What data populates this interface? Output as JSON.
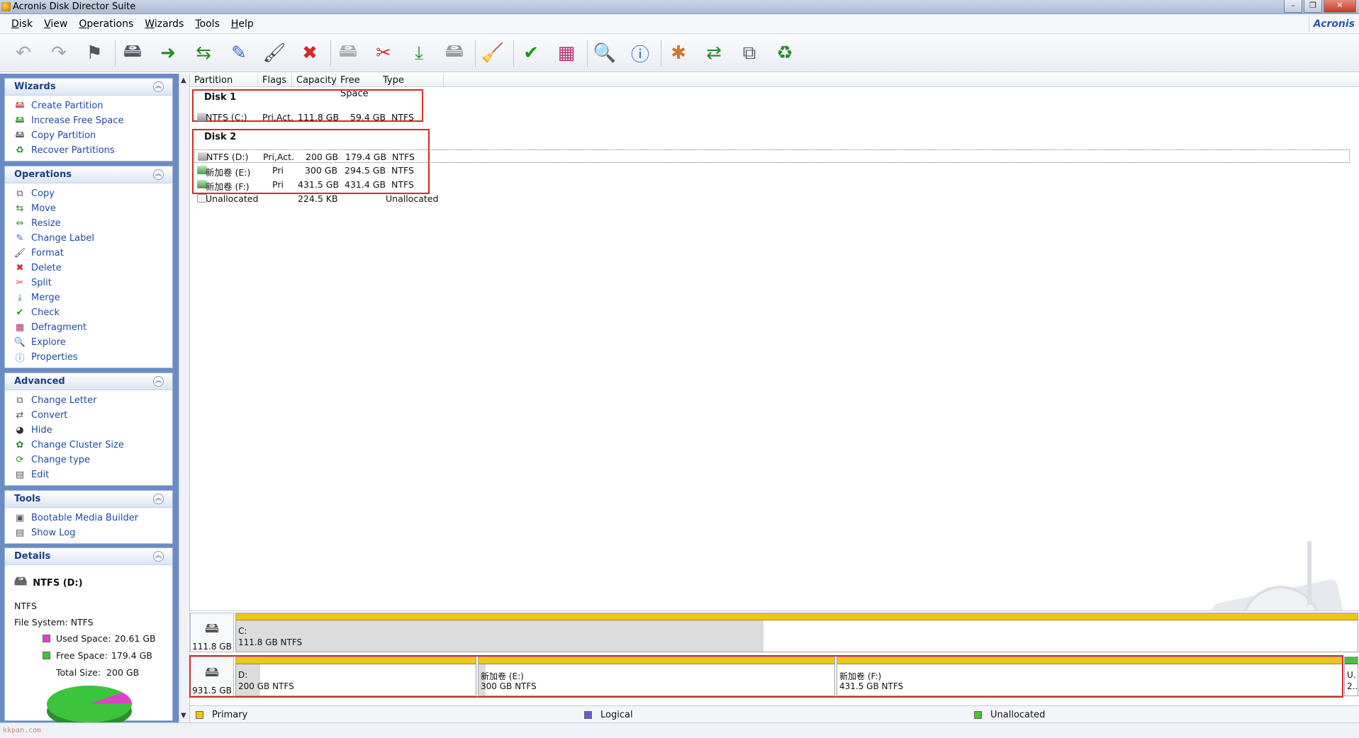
{
  "window": {
    "title": "Acronis Disk Director Suite",
    "brand": "Acronis"
  },
  "menu": [
    {
      "label": "Disk",
      "ul": "D",
      "rest": "isk"
    },
    {
      "label": "View",
      "ul": "V",
      "rest": "iew"
    },
    {
      "label": "Operations",
      "ul": "O",
      "rest": "perations"
    },
    {
      "label": "Wizards",
      "ul": "W",
      "rest": "izards"
    },
    {
      "label": "Tools",
      "ul": "T",
      "rest": "ools"
    },
    {
      "label": "Help",
      "ul": "H",
      "rest": "elp"
    }
  ],
  "toolbar": {
    "buttons": [
      "undo-icon",
      "redo-icon",
      "commit-icon",
      "create-partition-icon",
      "copy-partition-icon",
      "move-partition-icon",
      "change-label-icon",
      "format-icon",
      "delete-icon",
      "split-icon",
      "merge-icon",
      "increase-space-icon",
      "hide-icon",
      "clean-icon",
      "check-icon",
      "defragment-icon",
      "explore-icon",
      "properties-icon",
      "bootable-media-icon",
      "recover-icon",
      "change-letter-icon",
      "refresh-icon"
    ]
  },
  "sidebar": {
    "wizards": {
      "title": "Wizards",
      "items": [
        {
          "label": "Create Partition",
          "icon": "create-partition-icon"
        },
        {
          "label": "Increase Free Space",
          "icon": "increase-space-icon"
        },
        {
          "label": "Copy Partition",
          "icon": "copy-partition-icon"
        },
        {
          "label": "Recover Partitions",
          "icon": "recover-icon"
        }
      ]
    },
    "operations": {
      "title": "Operations",
      "items": [
        {
          "label": "Copy",
          "icon": "copy-icon"
        },
        {
          "label": "Move",
          "icon": "move-icon"
        },
        {
          "label": "Resize",
          "icon": "resize-icon"
        },
        {
          "label": "Change Label",
          "icon": "label-icon"
        },
        {
          "label": "Format",
          "icon": "format-icon"
        },
        {
          "label": "Delete",
          "icon": "delete-icon"
        },
        {
          "label": "Split",
          "icon": "split-icon"
        },
        {
          "label": "Merge",
          "icon": "merge-icon"
        },
        {
          "label": "Check",
          "icon": "check-icon"
        },
        {
          "label": "Defragment",
          "icon": "defragment-icon"
        },
        {
          "label": "Explore",
          "icon": "explore-icon"
        },
        {
          "label": "Properties",
          "icon": "properties-icon"
        }
      ]
    },
    "advanced": {
      "title": "Advanced",
      "items": [
        {
          "label": "Change Letter",
          "icon": "change-letter-icon"
        },
        {
          "label": "Convert",
          "icon": "convert-icon"
        },
        {
          "label": "Hide",
          "icon": "hide-icon"
        },
        {
          "label": "Change Cluster Size",
          "icon": "cluster-icon"
        },
        {
          "label": "Change type",
          "icon": "change-type-icon"
        },
        {
          "label": "Edit",
          "icon": "edit-icon"
        }
      ]
    },
    "tools": {
      "title": "Tools",
      "items": [
        {
          "label": "Bootable Media Builder",
          "icon": "bootable-media-icon"
        },
        {
          "label": "Show Log",
          "icon": "log-icon"
        }
      ]
    },
    "details": {
      "title": "Details",
      "name": "NTFS (D:)",
      "fs_short": "NTFS",
      "fs_line": "File System: NTFS",
      "used_label": "Used Space:",
      "used_value": "20.61 GB",
      "free_label": "Free Space:",
      "free_value": "179.4 GB",
      "total_label": "Total Size:",
      "total_value": "200 GB",
      "used_fraction": 0.103,
      "used_color": "#e040c8",
      "free_color": "#3cc43c"
    }
  },
  "table": {
    "headers": [
      "Partition",
      "Flags",
      "Capacity",
      "Free Space",
      "Type"
    ],
    "disk1": {
      "label": "Disk 1",
      "rows": [
        {
          "partition": "NTFS (C:)",
          "flags": "Pri,Act.",
          "capacity": "111.8 GB",
          "free": "59.4 GB",
          "type": "NTFS"
        }
      ]
    },
    "disk2": {
      "label": "Disk 2",
      "rows": [
        {
          "partition": "NTFS (D:)",
          "flags": "Pri,Act.",
          "capacity": "200 GB",
          "free": "179.4 GB",
          "type": "NTFS"
        },
        {
          "partition": "新加卷 (E:)",
          "flags": "Pri",
          "capacity": "300 GB",
          "free": "294.5 GB",
          "type": "NTFS"
        },
        {
          "partition": "新加卷 (F:)",
          "flags": "Pri",
          "capacity": "431.5 GB",
          "free": "431.4 GB",
          "type": "NTFS"
        }
      ],
      "unallocated": {
        "partition": "Unallocated",
        "capacity": "224.5 KB",
        "type": "Unallocated"
      }
    }
  },
  "diskmap": {
    "disk1": {
      "size": "111.8 GB",
      "parts": [
        {
          "t1": "C:",
          "t2": "111.8 GB  NTFS",
          "used_fraction": 0.47
        }
      ]
    },
    "disk2": {
      "size": "931.5 GB",
      "parts": [
        {
          "t1": "D:",
          "t2": "200 GB  NTFS",
          "used_fraction": 0.1
        },
        {
          "t1": "新加卷 (E:)",
          "t2": "300 GB  NTFS",
          "used_fraction": 0.02
        },
        {
          "t1": "新加卷 (F:)",
          "t2": "431.5 GB  NTFS",
          "used_fraction": 0.0
        },
        {
          "t1": "U.",
          "t2": "2..",
          "used_fraction": 0.0
        }
      ]
    }
  },
  "legend": [
    {
      "label": "Primary",
      "color": "#f0c419"
    },
    {
      "label": "Logical",
      "color": "#6a5acd"
    },
    {
      "label": "Unallocated",
      "color": "#4cbf3c"
    }
  ],
  "watermark": "kkpan.com"
}
